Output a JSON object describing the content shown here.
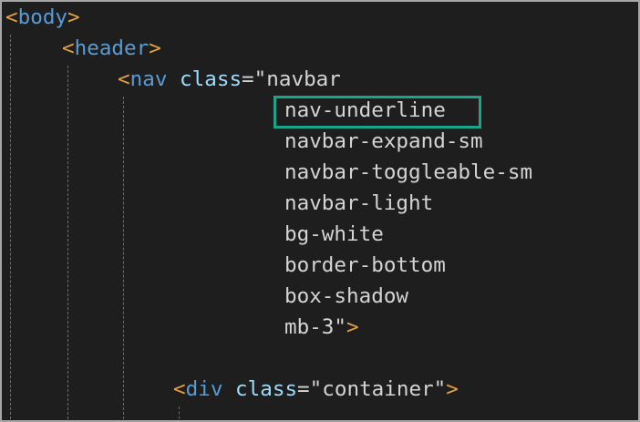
{
  "editor": {
    "theme_background": "#1e1e1e",
    "colors": {
      "tag": "#569cd6",
      "bracket": "#e8a33d",
      "attribute": "#9cdcfe",
      "text": "#d4d4d4",
      "highlight": "#1aa58a"
    },
    "lines": {
      "l1": {
        "open": "<",
        "tag": "body",
        "close": ">"
      },
      "l2": {
        "open": "<",
        "tag": "header",
        "close": ">"
      },
      "l3": {
        "open": "<",
        "tag": "nav",
        "attr": "class",
        "eq": "=",
        "value": "\"navbar"
      },
      "l4": {
        "value": "nav-underline"
      },
      "l5": {
        "value": "navbar-expand-sm"
      },
      "l6": {
        "value": "navbar-toggleable-sm"
      },
      "l7": {
        "value": "navbar-light"
      },
      "l8": {
        "value": "bg-white"
      },
      "l9": {
        "value": "border-bottom"
      },
      "l10": {
        "value": "box-shadow"
      },
      "l11": {
        "value": "mb-3\"",
        "close": ">"
      },
      "l13": {
        "open": "<",
        "tag": "div",
        "attr": "class",
        "eq": "=",
        "value": "\"container\"",
        "close": ">"
      }
    },
    "highlighted_class": "nav-underline"
  }
}
